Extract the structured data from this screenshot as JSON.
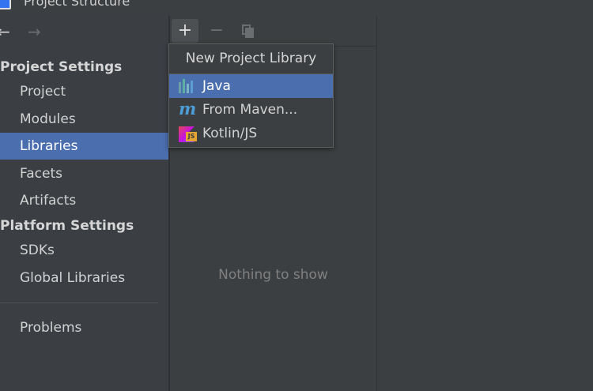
{
  "window": {
    "title": "Project Structure"
  },
  "nav": {
    "back": "←",
    "forward": "→"
  },
  "sidebar": {
    "project_settings_header": "Project Settings",
    "project_items": [
      {
        "label": "Project"
      },
      {
        "label": "Modules"
      },
      {
        "label": "Libraries",
        "selected": true
      },
      {
        "label": "Facets"
      },
      {
        "label": "Artifacts"
      }
    ],
    "platform_settings_header": "Platform Settings",
    "platform_items": [
      {
        "label": "SDKs"
      },
      {
        "label": "Global Libraries"
      }
    ],
    "problems": {
      "label": "Problems"
    }
  },
  "toolbar": {
    "add": "+",
    "remove": "−"
  },
  "middle": {
    "empty_text": "Nothing to show"
  },
  "popup": {
    "title": "New Project Library",
    "items": [
      {
        "label": "Java",
        "icon": "java-library-icon",
        "selected": true
      },
      {
        "label": "From Maven...",
        "icon": "maven-icon"
      },
      {
        "label": "Kotlin/JS",
        "icon": "kotlin-js-icon"
      }
    ]
  },
  "colors": {
    "selection": "#4b6eaf",
    "background": "#3c3f41",
    "sidebar": "#3b3f44"
  }
}
